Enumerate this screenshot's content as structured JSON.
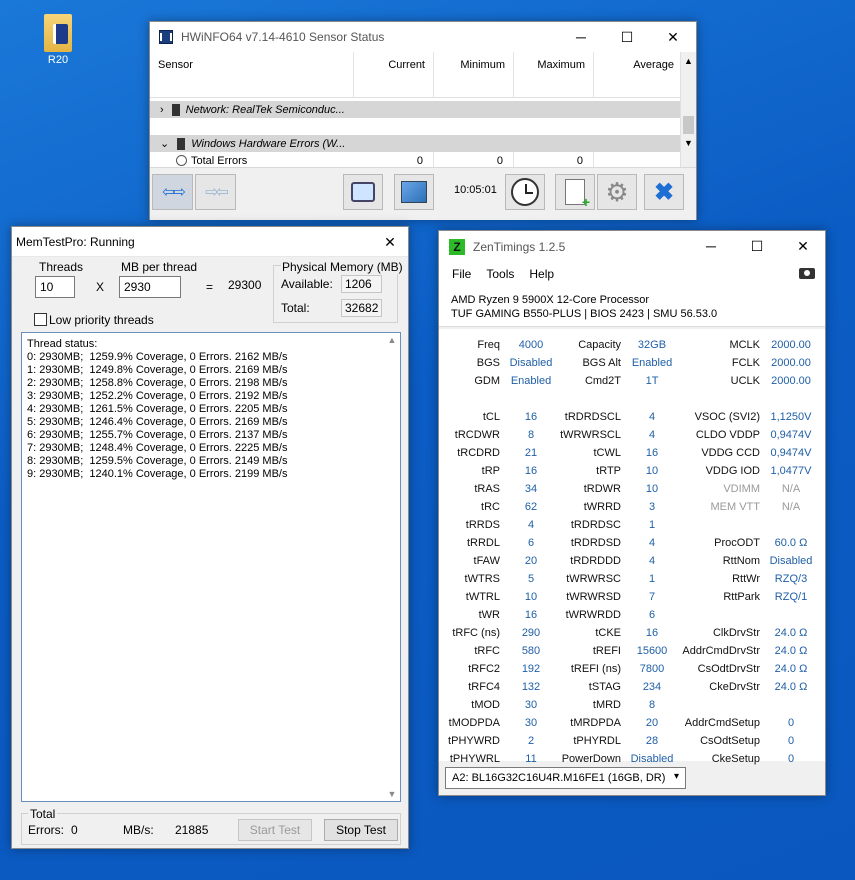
{
  "desktop": {
    "icon_label": "R20"
  },
  "hwinfo": {
    "title": "HWiNFO64 v7.14-4610 Sensor Status",
    "columns": [
      "Sensor",
      "Current",
      "Minimum",
      "Maximum",
      "Average"
    ],
    "rows": [
      {
        "name": "Network: RealTek Semiconduc...",
        "current": "",
        "minimum": "",
        "maximum": "",
        "average": ""
      },
      {
        "name": "Windows Hardware Errors (W...",
        "current": "",
        "minimum": "",
        "maximum": "",
        "average": ""
      },
      {
        "name": "Total Errors",
        "current": "0",
        "minimum": "0",
        "maximum": "0",
        "average": ""
      }
    ],
    "time": "10:05:01"
  },
  "memtest": {
    "title": "MemTestPro: Running",
    "threads_label": "Threads",
    "threads_value": "10",
    "mb_label": "MB per thread",
    "mb_value": "2930",
    "times": "X",
    "equals": "=",
    "total_mb": "29300",
    "phys_label": "Physical Memory (MB)",
    "available_label": "Available:",
    "available_value": "1206",
    "total_label": "Total:",
    "total_value": "32682",
    "low_priority": "Low priority threads",
    "thread_status": "Thread status:\n0: 2930MB;  1259.9% Coverage, 0 Errors. 2162 MB/s\n1: 2930MB;  1249.8% Coverage, 0 Errors. 2169 MB/s\n2: 2930MB;  1258.8% Coverage, 0 Errors. 2198 MB/s\n3: 2930MB;  1252.2% Coverage, 0 Errors. 2192 MB/s\n4: 2930MB;  1261.5% Coverage, 0 Errors. 2205 MB/s\n5: 2930MB;  1246.4% Coverage, 0 Errors. 2169 MB/s\n6: 2930MB;  1255.7% Coverage, 0 Errors. 2137 MB/s\n7: 2930MB;  1248.4% Coverage, 0 Errors. 2225 MB/s\n8: 2930MB;  1259.5% Coverage, 0 Errors. 2149 MB/s\n9: 2930MB;  1240.1% Coverage, 0 Errors. 2199 MB/s",
    "total_group": "Total",
    "errors_label": "Errors:",
    "errors_value": "0",
    "mbs_label": "MB/s:",
    "mbs_value": "21885",
    "start_label": "Start Test",
    "stop_label": "Stop Test"
  },
  "zen": {
    "title": "ZenTimings 1.2.5",
    "menu": [
      "File",
      "Tools",
      "Help"
    ],
    "cpu": "AMD Ryzen 9 5900X 12-Core Processor",
    "board": "TUF GAMING B550-PLUS | BIOS 2423 | SMU 56.53.0",
    "col1": [
      [
        "Freq",
        "4000"
      ],
      [
        "BGS",
        "Disabled"
      ],
      [
        "GDM",
        "Enabled"
      ],
      [
        "",
        ""
      ],
      [
        "tCL",
        "16"
      ],
      [
        "tRCDWR",
        "8"
      ],
      [
        "tRCDRD",
        "21"
      ],
      [
        "tRP",
        "16"
      ],
      [
        "tRAS",
        "34"
      ],
      [
        "tRC",
        "62"
      ],
      [
        "tRRDS",
        "4"
      ],
      [
        "tRRDL",
        "6"
      ],
      [
        "tFAW",
        "20"
      ],
      [
        "tWTRS",
        "5"
      ],
      [
        "tWTRL",
        "10"
      ],
      [
        "tWR",
        "16"
      ],
      [
        "tRFC (ns)",
        "290"
      ],
      [
        "tRFC",
        "580"
      ],
      [
        "tRFC2",
        "192"
      ],
      [
        "tRFC4",
        "132"
      ],
      [
        "tMOD",
        "30"
      ],
      [
        "tMODPDA",
        "30"
      ],
      [
        "tPHYWRD",
        "2"
      ],
      [
        "tPHYWRL",
        "11"
      ]
    ],
    "col2": [
      [
        "Capacity",
        "32GB"
      ],
      [
        "BGS Alt",
        "Enabled"
      ],
      [
        "Cmd2T",
        "1T"
      ],
      [
        "",
        ""
      ],
      [
        "tRDRDSCL",
        "4"
      ],
      [
        "tWRWRSCL",
        "4"
      ],
      [
        "tCWL",
        "16"
      ],
      [
        "tRTP",
        "10"
      ],
      [
        "tRDWR",
        "10"
      ],
      [
        "tWRRD",
        "3"
      ],
      [
        "tRDRDSC",
        "1"
      ],
      [
        "tRDRDSD",
        "4"
      ],
      [
        "tRDRDDD",
        "4"
      ],
      [
        "tWRWRSC",
        "1"
      ],
      [
        "tWRWRSD",
        "7"
      ],
      [
        "tWRWRDD",
        "6"
      ],
      [
        "tCKE",
        "16"
      ],
      [
        "tREFI",
        "15600"
      ],
      [
        "tREFI (ns)",
        "7800"
      ],
      [
        "tSTAG",
        "234"
      ],
      [
        "tMRD",
        "8"
      ],
      [
        "tMRDPDA",
        "20"
      ],
      [
        "tPHYRDL",
        "28"
      ],
      [
        "PowerDown",
        "Disabled"
      ]
    ],
    "col3": [
      [
        "MCLK",
        "2000.00"
      ],
      [
        "FCLK",
        "2000.00"
      ],
      [
        "UCLK",
        "2000.00"
      ],
      [
        "",
        ""
      ],
      [
        "VSOC (SVI2)",
        "1,1250V"
      ],
      [
        "CLDO VDDP",
        "0,9474V"
      ],
      [
        "VDDG CCD",
        "0,9474V"
      ],
      [
        "VDDG IOD",
        "1,0477V"
      ],
      [
        "VDIMM",
        "N/A"
      ],
      [
        "MEM VTT",
        "N/A"
      ],
      [
        "",
        ""
      ],
      [
        "ProcODT",
        "60.0 Ω"
      ],
      [
        "RttNom",
        "Disabled"
      ],
      [
        "RttWr",
        "RZQ/3"
      ],
      [
        "RttPark",
        "RZQ/1"
      ],
      [
        "",
        ""
      ],
      [
        "ClkDrvStr",
        "24.0 Ω"
      ],
      [
        "AddrCmdDrvStr",
        "24.0 Ω"
      ],
      [
        "CsOdtDrvStr",
        "24.0 Ω"
      ],
      [
        "CkeDrvStr",
        "24.0 Ω"
      ],
      [
        "",
        ""
      ],
      [
        "AddrCmdSetup",
        "0"
      ],
      [
        "CsOdtSetup",
        "0"
      ],
      [
        "CkeSetup",
        "0"
      ]
    ],
    "dimm_select": "A2: BL16G32C16U4R.M16FE1 (16GB, DR)",
    "colors": {
      "value": "#1f5fa6",
      "accent": "#2cba29"
    }
  }
}
